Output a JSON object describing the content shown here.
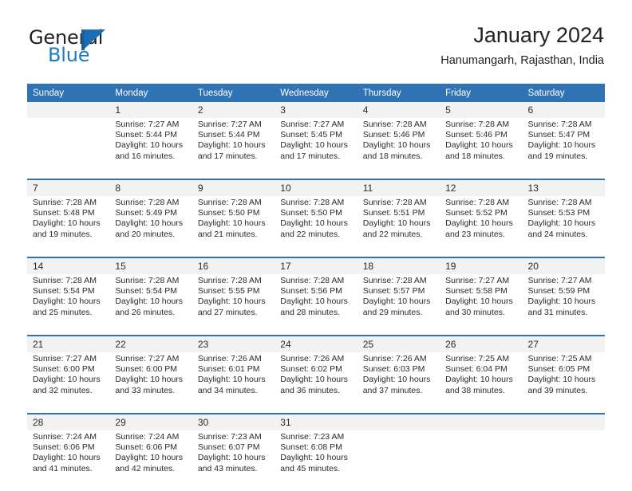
{
  "logo": {
    "text_primary": "General",
    "text_secondary": "Blue",
    "mark": "flag-triangle"
  },
  "header": {
    "title": "January 2024",
    "location": "Hanumangarh, Rajasthan, India"
  },
  "colors": {
    "header_blue": "#3073B4",
    "daynum_band": "#F2F2F2",
    "logo_blue": "#1b7ac4",
    "text": "#2a2a2a"
  },
  "weekday_headers": [
    "Sunday",
    "Monday",
    "Tuesday",
    "Wednesday",
    "Thursday",
    "Friday",
    "Saturday"
  ],
  "weeks": [
    {
      "daynums": [
        "",
        "1",
        "2",
        "3",
        "4",
        "5",
        "6"
      ],
      "cells": [
        {
          "sunrise": "",
          "sunset": "",
          "daylight1": "",
          "daylight2": ""
        },
        {
          "sunrise": "Sunrise: 7:27 AM",
          "sunset": "Sunset: 5:44 PM",
          "daylight1": "Daylight: 10 hours",
          "daylight2": "and 16 minutes."
        },
        {
          "sunrise": "Sunrise: 7:27 AM",
          "sunset": "Sunset: 5:44 PM",
          "daylight1": "Daylight: 10 hours",
          "daylight2": "and 17 minutes."
        },
        {
          "sunrise": "Sunrise: 7:27 AM",
          "sunset": "Sunset: 5:45 PM",
          "daylight1": "Daylight: 10 hours",
          "daylight2": "and 17 minutes."
        },
        {
          "sunrise": "Sunrise: 7:28 AM",
          "sunset": "Sunset: 5:46 PM",
          "daylight1": "Daylight: 10 hours",
          "daylight2": "and 18 minutes."
        },
        {
          "sunrise": "Sunrise: 7:28 AM",
          "sunset": "Sunset: 5:46 PM",
          "daylight1": "Daylight: 10 hours",
          "daylight2": "and 18 minutes."
        },
        {
          "sunrise": "Sunrise: 7:28 AM",
          "sunset": "Sunset: 5:47 PM",
          "daylight1": "Daylight: 10 hours",
          "daylight2": "and 19 minutes."
        }
      ]
    },
    {
      "daynums": [
        "7",
        "8",
        "9",
        "10",
        "11",
        "12",
        "13"
      ],
      "cells": [
        {
          "sunrise": "Sunrise: 7:28 AM",
          "sunset": "Sunset: 5:48 PM",
          "daylight1": "Daylight: 10 hours",
          "daylight2": "and 19 minutes."
        },
        {
          "sunrise": "Sunrise: 7:28 AM",
          "sunset": "Sunset: 5:49 PM",
          "daylight1": "Daylight: 10 hours",
          "daylight2": "and 20 minutes."
        },
        {
          "sunrise": "Sunrise: 7:28 AM",
          "sunset": "Sunset: 5:50 PM",
          "daylight1": "Daylight: 10 hours",
          "daylight2": "and 21 minutes."
        },
        {
          "sunrise": "Sunrise: 7:28 AM",
          "sunset": "Sunset: 5:50 PM",
          "daylight1": "Daylight: 10 hours",
          "daylight2": "and 22 minutes."
        },
        {
          "sunrise": "Sunrise: 7:28 AM",
          "sunset": "Sunset: 5:51 PM",
          "daylight1": "Daylight: 10 hours",
          "daylight2": "and 22 minutes."
        },
        {
          "sunrise": "Sunrise: 7:28 AM",
          "sunset": "Sunset: 5:52 PM",
          "daylight1": "Daylight: 10 hours",
          "daylight2": "and 23 minutes."
        },
        {
          "sunrise": "Sunrise: 7:28 AM",
          "sunset": "Sunset: 5:53 PM",
          "daylight1": "Daylight: 10 hours",
          "daylight2": "and 24 minutes."
        }
      ]
    },
    {
      "daynums": [
        "14",
        "15",
        "16",
        "17",
        "18",
        "19",
        "20"
      ],
      "cells": [
        {
          "sunrise": "Sunrise: 7:28 AM",
          "sunset": "Sunset: 5:54 PM",
          "daylight1": "Daylight: 10 hours",
          "daylight2": "and 25 minutes."
        },
        {
          "sunrise": "Sunrise: 7:28 AM",
          "sunset": "Sunset: 5:54 PM",
          "daylight1": "Daylight: 10 hours",
          "daylight2": "and 26 minutes."
        },
        {
          "sunrise": "Sunrise: 7:28 AM",
          "sunset": "Sunset: 5:55 PM",
          "daylight1": "Daylight: 10 hours",
          "daylight2": "and 27 minutes."
        },
        {
          "sunrise": "Sunrise: 7:28 AM",
          "sunset": "Sunset: 5:56 PM",
          "daylight1": "Daylight: 10 hours",
          "daylight2": "and 28 minutes."
        },
        {
          "sunrise": "Sunrise: 7:28 AM",
          "sunset": "Sunset: 5:57 PM",
          "daylight1": "Daylight: 10 hours",
          "daylight2": "and 29 minutes."
        },
        {
          "sunrise": "Sunrise: 7:27 AM",
          "sunset": "Sunset: 5:58 PM",
          "daylight1": "Daylight: 10 hours",
          "daylight2": "and 30 minutes."
        },
        {
          "sunrise": "Sunrise: 7:27 AM",
          "sunset": "Sunset: 5:59 PM",
          "daylight1": "Daylight: 10 hours",
          "daylight2": "and 31 minutes."
        }
      ]
    },
    {
      "daynums": [
        "21",
        "22",
        "23",
        "24",
        "25",
        "26",
        "27"
      ],
      "cells": [
        {
          "sunrise": "Sunrise: 7:27 AM",
          "sunset": "Sunset: 6:00 PM",
          "daylight1": "Daylight: 10 hours",
          "daylight2": "and 32 minutes."
        },
        {
          "sunrise": "Sunrise: 7:27 AM",
          "sunset": "Sunset: 6:00 PM",
          "daylight1": "Daylight: 10 hours",
          "daylight2": "and 33 minutes."
        },
        {
          "sunrise": "Sunrise: 7:26 AM",
          "sunset": "Sunset: 6:01 PM",
          "daylight1": "Daylight: 10 hours",
          "daylight2": "and 34 minutes."
        },
        {
          "sunrise": "Sunrise: 7:26 AM",
          "sunset": "Sunset: 6:02 PM",
          "daylight1": "Daylight: 10 hours",
          "daylight2": "and 36 minutes."
        },
        {
          "sunrise": "Sunrise: 7:26 AM",
          "sunset": "Sunset: 6:03 PM",
          "daylight1": "Daylight: 10 hours",
          "daylight2": "and 37 minutes."
        },
        {
          "sunrise": "Sunrise: 7:25 AM",
          "sunset": "Sunset: 6:04 PM",
          "daylight1": "Daylight: 10 hours",
          "daylight2": "and 38 minutes."
        },
        {
          "sunrise": "Sunrise: 7:25 AM",
          "sunset": "Sunset: 6:05 PM",
          "daylight1": "Daylight: 10 hours",
          "daylight2": "and 39 minutes."
        }
      ]
    },
    {
      "daynums": [
        "28",
        "29",
        "30",
        "31",
        "",
        "",
        ""
      ],
      "cells": [
        {
          "sunrise": "Sunrise: 7:24 AM",
          "sunset": "Sunset: 6:06 PM",
          "daylight1": "Daylight: 10 hours",
          "daylight2": "and 41 minutes."
        },
        {
          "sunrise": "Sunrise: 7:24 AM",
          "sunset": "Sunset: 6:06 PM",
          "daylight1": "Daylight: 10 hours",
          "daylight2": "and 42 minutes."
        },
        {
          "sunrise": "Sunrise: 7:23 AM",
          "sunset": "Sunset: 6:07 PM",
          "daylight1": "Daylight: 10 hours",
          "daylight2": "and 43 minutes."
        },
        {
          "sunrise": "Sunrise: 7:23 AM",
          "sunset": "Sunset: 6:08 PM",
          "daylight1": "Daylight: 10 hours",
          "daylight2": "and 45 minutes."
        },
        {
          "sunrise": "",
          "sunset": "",
          "daylight1": "",
          "daylight2": ""
        },
        {
          "sunrise": "",
          "sunset": "",
          "daylight1": "",
          "daylight2": ""
        },
        {
          "sunrise": "",
          "sunset": "",
          "daylight1": "",
          "daylight2": ""
        }
      ]
    }
  ]
}
